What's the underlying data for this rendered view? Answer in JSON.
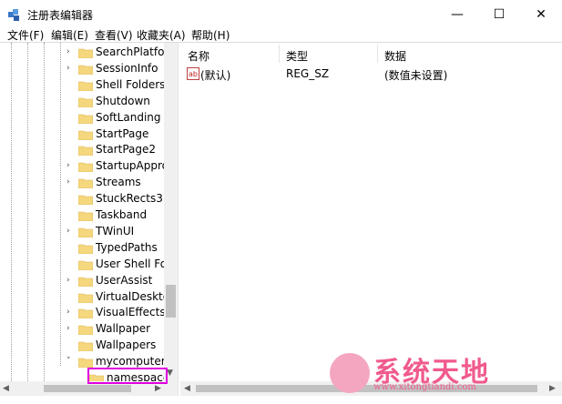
{
  "window": {
    "title": "注册表编辑器",
    "minimize": "—",
    "maximize": "☐",
    "close": "✕"
  },
  "menu": [
    "文件(F)",
    "编辑(E)",
    "查看(V)",
    "收藏夹(A)",
    "帮助(H)"
  ],
  "tree": {
    "items": [
      {
        "label": "SearchPlatform",
        "expandable": true
      },
      {
        "label": "SessionInfo",
        "expandable": true
      },
      {
        "label": "Shell Folders",
        "expandable": false
      },
      {
        "label": "Shutdown",
        "expandable": false
      },
      {
        "label": "SoftLanding",
        "expandable": false
      },
      {
        "label": "StartPage",
        "expandable": false
      },
      {
        "label": "StartPage2",
        "expandable": false
      },
      {
        "label": "StartupApprov",
        "expandable": true
      },
      {
        "label": "Streams",
        "expandable": true
      },
      {
        "label": "StuckRects3",
        "expandable": false
      },
      {
        "label": "Taskband",
        "expandable": false
      },
      {
        "label": "TWinUI",
        "expandable": true
      },
      {
        "label": "TypedPaths",
        "expandable": false
      },
      {
        "label": "User Shell Fold",
        "expandable": false
      },
      {
        "label": "UserAssist",
        "expandable": true
      },
      {
        "label": "VirtualDesktop",
        "expandable": false
      },
      {
        "label": "VisualEffects",
        "expandable": true
      },
      {
        "label": "Wallpaper",
        "expandable": true
      },
      {
        "label": "Wallpapers",
        "expandable": false
      },
      {
        "label": "mycomputer",
        "expandable": true,
        "expanded": true
      },
      {
        "label": "namespace",
        "expandable": false,
        "selected": true
      }
    ]
  },
  "list": {
    "columns": [
      "名称",
      "类型",
      "数据"
    ],
    "rows": [
      {
        "name": "(默认)",
        "type": "REG_SZ",
        "data": "(数值未设置)",
        "icon": "string-value-icon"
      }
    ]
  },
  "watermark": {
    "brand": "系统天地",
    "url": "www.xitongtiandi.com"
  },
  "colors": {
    "highlight_border": "#e000e0",
    "folder": "#f5d77e",
    "watermark": "#f05a8c"
  }
}
